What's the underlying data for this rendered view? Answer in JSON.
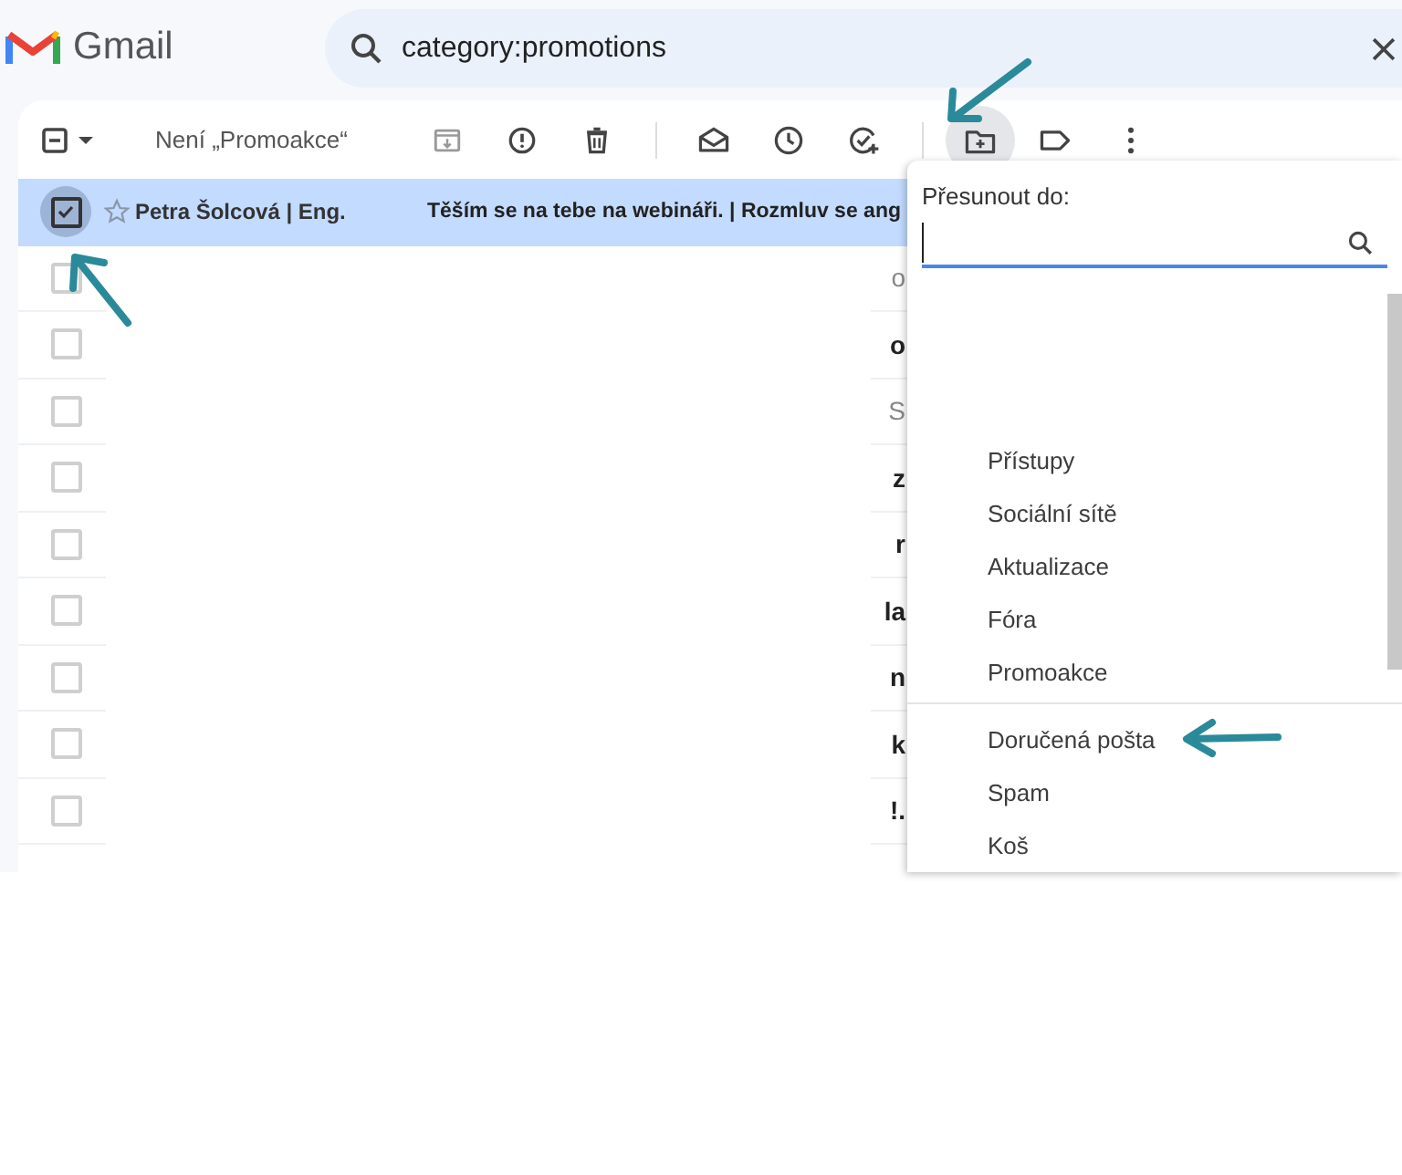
{
  "app": {
    "name": "Gmail"
  },
  "search": {
    "value": "category:promotions"
  },
  "toolbar": {
    "select_all": {
      "indeterminate": true
    },
    "label_button": "Není „Promoakce“"
  },
  "rows": [
    {
      "sender": "Petra Šolcová | Eng.",
      "subject": "Těším se na tebe na webináři. | Rozmluv se ang",
      "selected": true,
      "unread": true
    },
    {
      "column_3": "o",
      "selected": false,
      "unread": false
    },
    {
      "column_3": "o",
      "selected": false,
      "unread": true
    },
    {
      "column_3": "S",
      "selected": false,
      "unread": false
    },
    {
      "column_3": "z",
      "selected": false,
      "unread": true
    },
    {
      "column_3": "r",
      "selected": false,
      "unread": true
    },
    {
      "column_3": "la",
      "selected": false,
      "unread": true
    },
    {
      "column_3": "n",
      "selected": false,
      "unread": true
    },
    {
      "column_3": "k",
      "selected": false,
      "unread": true
    },
    {
      "column_3": "!.",
      "selected": false,
      "unread": true
    }
  ],
  "move_menu": {
    "title": "Přesunout do:",
    "items": [
      {
        "label": "Přístupy"
      },
      {
        "label": "Sociální sítě"
      },
      {
        "label": "Aktualizace"
      },
      {
        "label": "Fóra"
      },
      {
        "label": "Promoakce"
      }
    ],
    "fixed_items": [
      {
        "label": "Doručená pošta"
      },
      {
        "label": "Spam"
      },
      {
        "label": "Koš"
      }
    ]
  }
}
